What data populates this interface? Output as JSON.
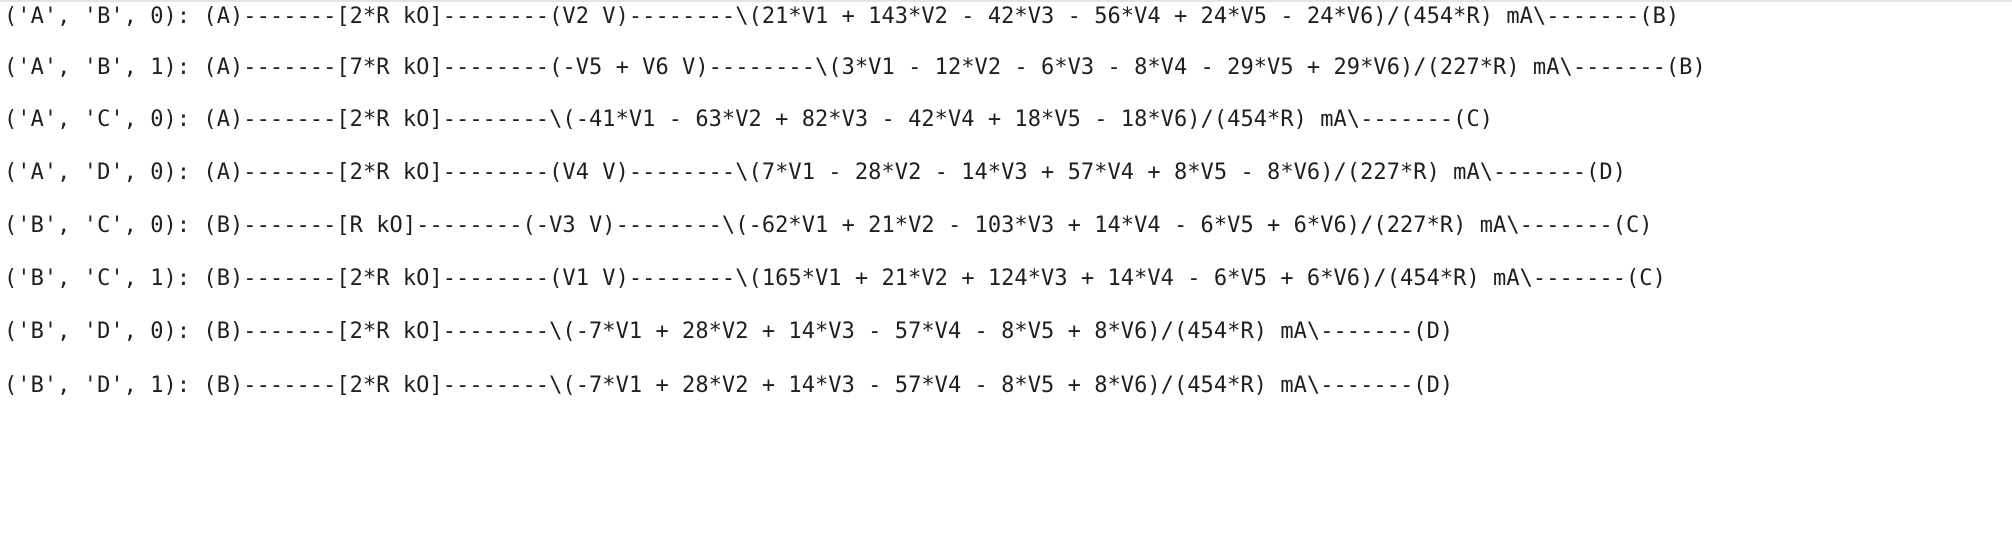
{
  "output": {
    "lines": [
      "('A', 'B', 0): (A)-------[2*R kO]--------(V2 V)--------\\(21*V1 + 143*V2 - 42*V3 - 56*V4 + 24*V5 - 24*V6)/(454*R) mA\\-------(B)",
      "('A', 'B', 1): (A)-------[7*R kO]--------(-V5 + V6 V)--------\\(3*V1 - 12*V2 - 6*V3 - 8*V4 - 29*V5 + 29*V6)/(227*R) mA\\-------(B)",
      "('A', 'C', 0): (A)-------[2*R kO]--------\\(-41*V1 - 63*V2 + 82*V3 - 42*V4 + 18*V5 - 18*V6)/(454*R) mA\\-------(C)",
      "('A', 'D', 0): (A)-------[2*R kO]--------(V4 V)--------\\(7*V1 - 28*V2 - 14*V3 + 57*V4 + 8*V5 - 8*V6)/(227*R) mA\\-------(D)",
      "('B', 'C', 0): (B)-------[R kO]--------(-V3 V)--------\\(-62*V1 + 21*V2 - 103*V3 + 14*V4 - 6*V5 + 6*V6)/(227*R) mA\\-------(C)",
      "('B', 'C', 1): (B)-------[2*R kO]--------(V1 V)--------\\(165*V1 + 21*V2 + 124*V3 + 14*V4 - 6*V5 + 6*V6)/(454*R) mA\\-------(C)",
      "('B', 'D', 0): (B)-------[2*R kO]--------\\(-7*V1 + 28*V2 + 14*V3 - 57*V4 - 8*V5 + 8*V6)/(454*R) mA\\-------(D)",
      "('B', 'D', 1): (B)-------[2*R kO]--------\\(-7*V1 + 28*V2 + 14*V3 - 57*V4 - 8*V5 + 8*V6)/(454*R) mA\\-------(D)"
    ]
  }
}
